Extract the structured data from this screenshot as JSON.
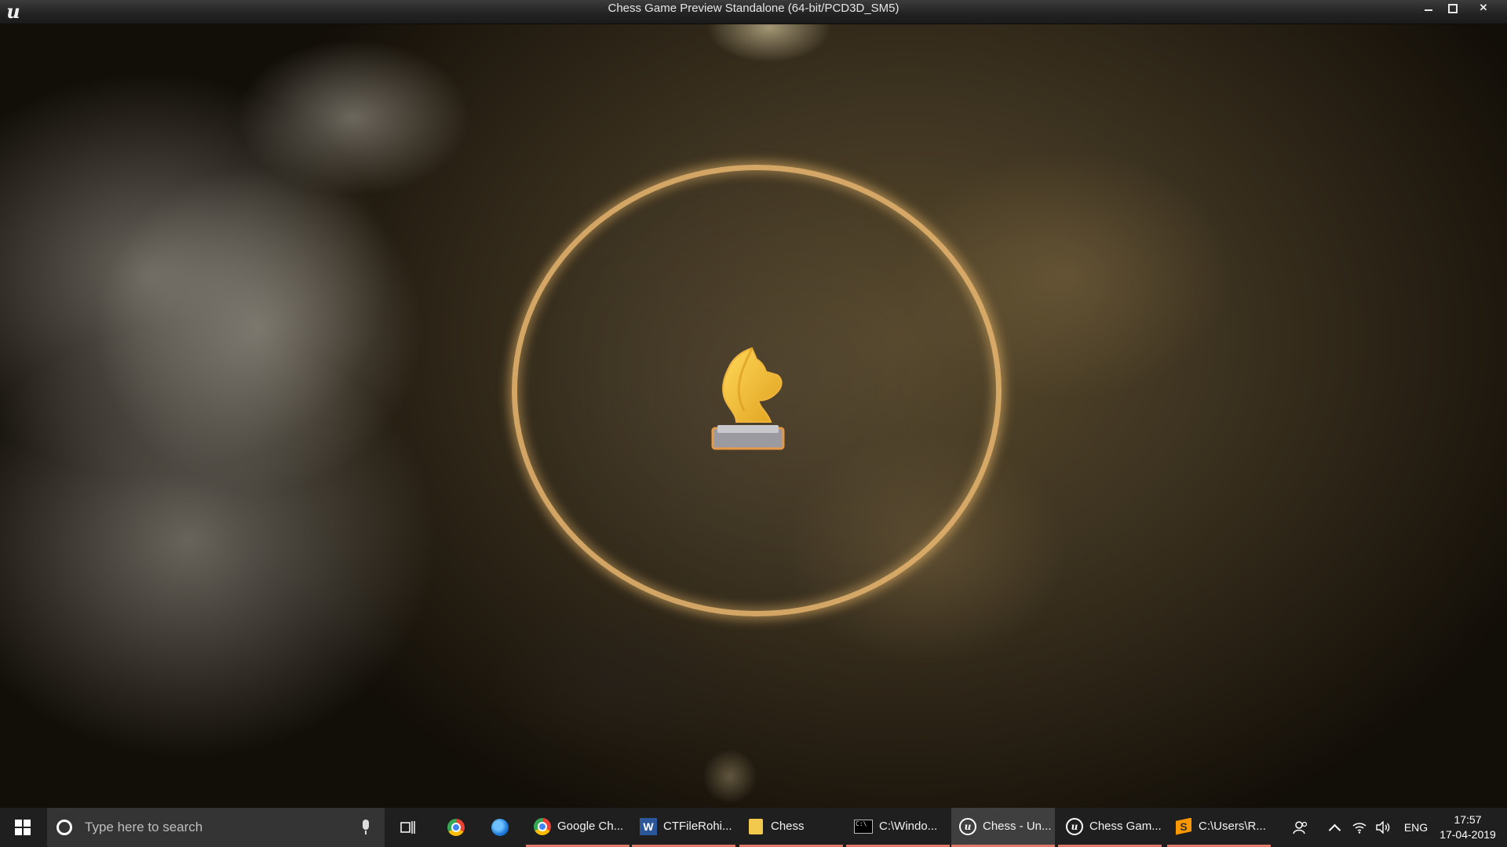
{
  "window": {
    "title": "Chess Game Preview Standalone (64-bit/PCD3D_SM5)",
    "app_icon": "unreal-engine-icon",
    "controls": {
      "minimize": "minimize-icon",
      "maximize": "restore-icon",
      "close": "close-icon"
    }
  },
  "viewport": {
    "logo": "chess-knight-icon",
    "ring_color": "#e6b46e",
    "knight_color": "#f5c23a"
  },
  "taskbar": {
    "search_placeholder": "Type here to search",
    "pinned": [
      {
        "name": "Google Chrome",
        "icon": "chrome-icon"
      },
      {
        "name": "Firefox",
        "icon": "firefox-icon"
      }
    ],
    "apps": [
      {
        "label": "Google Ch...",
        "icon": "chrome-icon"
      },
      {
        "label": "CTFileRohi...",
        "icon": "word-icon"
      },
      {
        "label": "Chess",
        "icon": "folder-icon"
      },
      {
        "label": "C:\\Windo...",
        "icon": "cmd-icon"
      },
      {
        "label": "Chess - Un...",
        "icon": "unreal-engine-icon",
        "active": true
      },
      {
        "label": "Chess Gam...",
        "icon": "unreal-engine-icon"
      },
      {
        "label": "C:\\Users\\R...",
        "icon": "sublime-text-icon"
      }
    ],
    "tray": {
      "language": "ENG",
      "time": "17:57",
      "date": "17-04-2019"
    },
    "accent_color": "#e07a6a"
  }
}
